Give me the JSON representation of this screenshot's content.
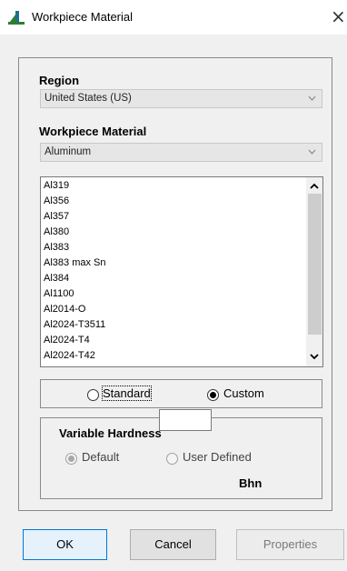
{
  "window": {
    "title": "Workpiece Material",
    "close_glyph": "×",
    "app_icon": "tool-icon"
  },
  "region": {
    "label": "Region",
    "selected": "United States (US)"
  },
  "material": {
    "label": "Workpiece Material",
    "selected": "Aluminum"
  },
  "material_list": {
    "items": [
      "Al319",
      "Al356",
      "Al357",
      "Al380",
      "Al383",
      "Al383 max Sn",
      "Al384",
      "Al1100",
      "Al2014-O",
      "Al2024-T3511",
      "Al2024-T4",
      "Al2024-T42"
    ]
  },
  "mode": {
    "standard_label": "Standard",
    "custom_label": "Custom",
    "selected": "Custom"
  },
  "hardness": {
    "title": "Variable Hardness",
    "default_label": "Default",
    "user_defined_label": "User Defined",
    "selected": "Default",
    "value": "",
    "unit": "Bhn"
  },
  "buttons": {
    "ok": "OK",
    "cancel": "Cancel",
    "properties": "Properties"
  }
}
